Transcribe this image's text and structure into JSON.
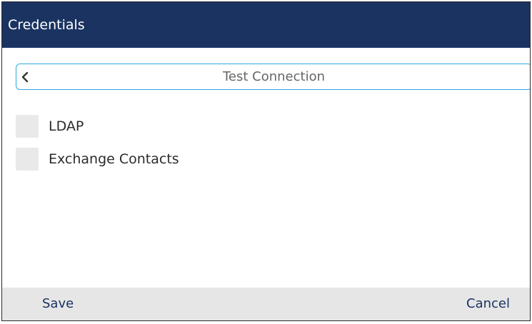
{
  "header": {
    "title": "Credentials"
  },
  "selector": {
    "value": "Test Connection",
    "left_icon": "chevron-left-icon"
  },
  "options": [
    {
      "label": "LDAP",
      "checked": false
    },
    {
      "label": "Exchange Contacts",
      "checked": false
    }
  ],
  "softkeys": {
    "save_label": "Save",
    "cancel_label": "Cancel"
  },
  "colors": {
    "header_bg": "#1a3361",
    "accent_border": "#2ea7e0",
    "checkbox_bg": "#e9e9ea",
    "footer_bg": "#e6e6e6",
    "softkey_text": "#1a3361"
  }
}
